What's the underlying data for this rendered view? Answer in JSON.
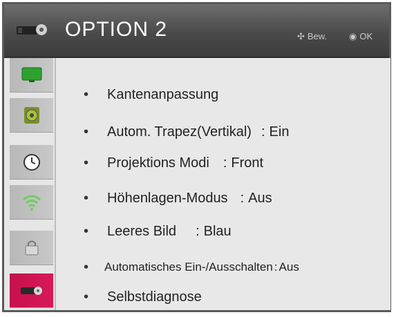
{
  "header": {
    "title": "OPTION 2",
    "hint_move": "Bew.",
    "hint_ok": "OK",
    "icon": "projector-gear-icon"
  },
  "sidebar": {
    "items": [
      {
        "icon": "monitor-icon",
        "active": false
      },
      {
        "icon": "speaker-icon",
        "active": false
      },
      {
        "icon": "clock-icon",
        "active": false
      },
      {
        "icon": "wifi-icon",
        "active": false
      },
      {
        "icon": "lock-icon",
        "active": false
      },
      {
        "icon": "projector-gear-icon",
        "active": true
      }
    ]
  },
  "menu": {
    "items": [
      {
        "label": "Kantenanpassung",
        "value": ""
      },
      {
        "label": "Autom. Trapez(Vertikal)",
        "value": "Ein"
      },
      {
        "label": "Projektions Modi",
        "value": "Front"
      },
      {
        "label": "Höhenlagen-Modus",
        "value": "Aus"
      },
      {
        "label": "Leeres Bild",
        "value": "Blau"
      },
      {
        "label": "Automatisches Ein-/Ausschalten",
        "value": "Aus"
      },
      {
        "label": "Selbstdiagnose",
        "value": ""
      }
    ]
  },
  "colors": {
    "header": "#4a4a4a",
    "active_tab": "#c6104c",
    "content_bg": "#e8e8e8"
  }
}
